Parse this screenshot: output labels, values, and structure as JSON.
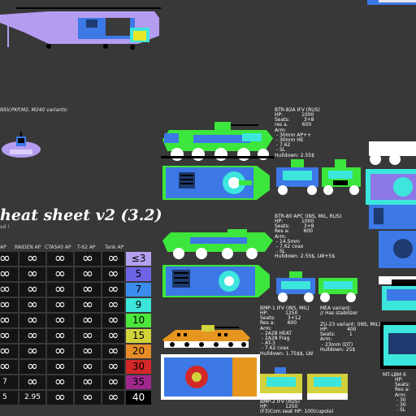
{
  "sheet": {
    "title": "heat sheet v2 (3.2)",
    "subtitle": "ed !",
    "variants_note": "NSV,PKP,M2, M240 variants:"
  },
  "columns": [
    "AP",
    "RAIDEN AP",
    "CTAS40 AP",
    "T-62 AP",
    "Tank AP"
  ],
  "infinity": "∞",
  "table_rows": [
    {
      "level": "≤3",
      "color": "#b4a0f0",
      "last_cells": [
        "∞",
        "∞"
      ]
    },
    {
      "level": "5",
      "color": "#6e64e6",
      "last_cells": [
        "∞",
        "∞"
      ]
    },
    {
      "level": "7",
      "color": "#3c8cf0",
      "last_cells": [
        "∞",
        "∞"
      ]
    },
    {
      "level": "9",
      "color": "#3ce6dc",
      "last_cells": [
        "∞",
        "∞"
      ]
    },
    {
      "level": "10",
      "color": "#4ce63c",
      "last_cells": [
        "∞",
        "∞"
      ]
    },
    {
      "level": "15",
      "color": "#d2d23c",
      "last_cells": [
        "∞",
        "∞"
      ]
    },
    {
      "level": "20",
      "color": "#e68c28",
      "last_cells": [
        "∞",
        "∞"
      ]
    },
    {
      "level": "30",
      "color": "#d22828",
      "last_cells": [
        "∞",
        "∞"
      ]
    },
    {
      "level": "35",
      "color": "#a0288c",
      "last_cells": [
        "7",
        "∞"
      ]
    },
    {
      "level": "40",
      "color": "#000000",
      "last_cells": [
        "5",
        "2.95"
      ]
    }
  ],
  "btr82a": {
    "name": "BTR-82A IFV (RUS)",
    "stats": "HP:            1000\nSeats:         3+8\nres a.         600\nArm:\n - 30mm AP++\n - 30mm HE\n - 7.62\n - SL\nHulldown: 2.55$"
  },
  "btr80": {
    "name": "BTR-80 APC (INS, MIL, RUS)",
    "stats": "HP:            1000\nSeats:         3+8\nRes a:         600\nArm:\n - 14.5mm\n - 7.62 coax\n - SL\nHulldown: 2.55$, LW+5$"
  },
  "bmp1": {
    "name": "BMP-1 IFV (INS, MIL)",
    "stats": "HP:           1250\nSeats:        3+12\nRes a:        600\nArm:\n - 2A28 HEAT\n - 2A28 Frag\n - AT-3\n - 7.62 coax\nHulldown: 1.75$$, LW"
  },
  "mea": {
    "name": "MEA variant:",
    "note": "// Has stabilizer"
  },
  "zu23": {
    "name": "ZU-23 variant: (INS, MIL)",
    "stats": "HP:            400\nSeats:         1\nArm:\n - 23mm (DT)\nHulldown: 25$"
  },
  "bmp2": {
    "name": "BMP-2 IFV (RUS)",
    "stats": "HP:           1250\n(F3)Com.seat HP: 100(cupola)"
  },
  "mtlbm": {
    "name": "MT-LBM 6",
    "stats": "HP:\nSeats:\nRes a:\nArm:\n - 30\n - 30\n - SL"
  },
  "colors": {
    "background": "#383838",
    "vehicle_green": "#3ce63c",
    "vehicle_blue": "#3c78e6",
    "vehicle_cyan": "#3cd2dc",
    "helicopter_lilac": "#b49cf0"
  }
}
